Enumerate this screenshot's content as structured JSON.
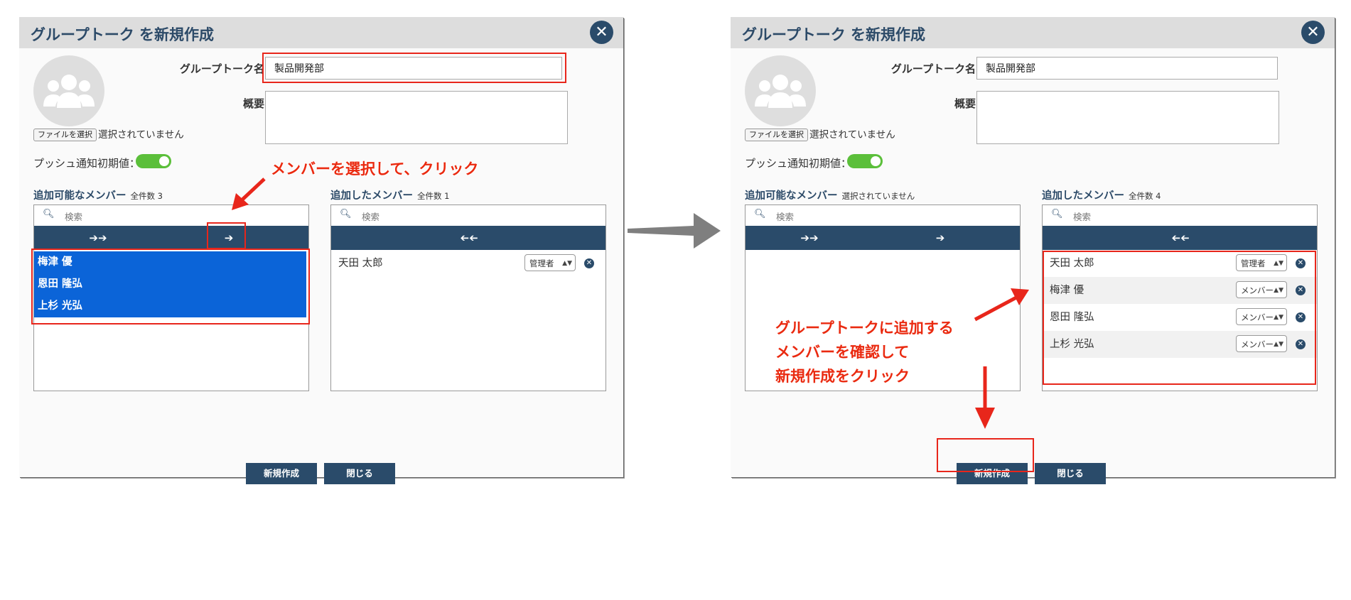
{
  "dialogs": [
    {
      "title": "グループトーク を新規作成",
      "name_label": "グループトーク名",
      "name_value": "製品開発部",
      "desc_label": "概要",
      "file_button": "ファイルを選択",
      "file_status": "選択されていません",
      "push_label": "プッシュ通知初期値：",
      "available_label": "追加可能なメンバー",
      "available_count": "全件数 3",
      "added_label": "追加したメンバー",
      "added_count": "全件数 1",
      "search_placeholder": "検索",
      "add_all": "➔➔",
      "add_selected": "➔",
      "remove_all": "➔➔",
      "available_members": [
        "梅津 優",
        "恩田 隆弘",
        "上杉 光弘"
      ],
      "added_members": [
        {
          "name": "天田 太郎",
          "role": "管理者"
        }
      ],
      "create_button": "新規作成",
      "close_button": "閉じる"
    },
    {
      "title": "グループトーク を新規作成",
      "name_label": "グループトーク名",
      "name_value": "製品開発部",
      "desc_label": "概要",
      "file_button": "ファイルを選択",
      "file_status": "選択されていません",
      "push_label": "プッシュ通知初期値：",
      "available_label": "追加可能なメンバー",
      "available_count": "選択されていません",
      "added_label": "追加したメンバー",
      "added_count": "全件数 4",
      "search_placeholder": "検索",
      "add_all": "➔➔",
      "add_selected": "➔",
      "remove_all": "➔➔",
      "available_members": [],
      "added_members": [
        {
          "name": "天田 太郎",
          "role": "管理者"
        },
        {
          "name": "梅津 優",
          "role": "メンバー"
        },
        {
          "name": "恩田 隆弘",
          "role": "メンバー"
        },
        {
          "name": "上杉 光弘",
          "role": "メンバー"
        }
      ],
      "create_button": "新規作成",
      "close_button": "閉じる"
    }
  ],
  "annotations": {
    "step1": "メンバーを選択して、クリック",
    "step2_line1": "グループトークに追加する",
    "step2_line2": "メンバーを確認して",
    "step2_line3": "新規作成をクリック"
  },
  "colors": {
    "navy": "#2a4b6a",
    "selection": "#0b64d8",
    "annotation_red": "#e8261b",
    "toggle_green": "#5bbf3a"
  }
}
